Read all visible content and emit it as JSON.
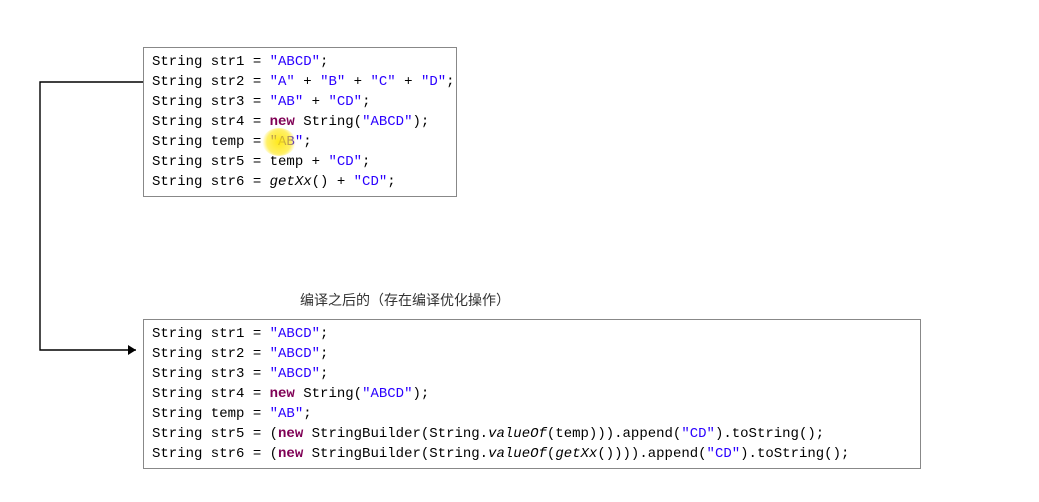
{
  "caption": "编译之后的（存在编译优化操作）",
  "top_code": {
    "lines": [
      [
        {
          "cls": "plain",
          "t": "String str1 = "
        },
        {
          "cls": "str",
          "t": "\"ABCD\""
        },
        {
          "cls": "plain",
          "t": ";"
        }
      ],
      [
        {
          "cls": "plain",
          "t": "String str2 = "
        },
        {
          "cls": "str",
          "t": "\"A\""
        },
        {
          "cls": "plain",
          "t": " + "
        },
        {
          "cls": "str",
          "t": "\"B\""
        },
        {
          "cls": "plain",
          "t": " + "
        },
        {
          "cls": "str",
          "t": "\"C\""
        },
        {
          "cls": "plain",
          "t": " + "
        },
        {
          "cls": "str",
          "t": "\"D\""
        },
        {
          "cls": "plain",
          "t": ";"
        }
      ],
      [
        {
          "cls": "plain",
          "t": "String str3 = "
        },
        {
          "cls": "str",
          "t": "\"AB\""
        },
        {
          "cls": "plain",
          "t": " + "
        },
        {
          "cls": "str",
          "t": "\"CD\""
        },
        {
          "cls": "plain",
          "t": ";"
        }
      ],
      [
        {
          "cls": "plain",
          "t": "String str4 = "
        },
        {
          "cls": "kw",
          "t": "new"
        },
        {
          "cls": "plain",
          "t": " String("
        },
        {
          "cls": "str",
          "t": "\"ABCD\""
        },
        {
          "cls": "plain",
          "t": ");"
        }
      ],
      [
        {
          "cls": "plain",
          "t": "String temp = "
        },
        {
          "cls": "str",
          "t": "\"AB\""
        },
        {
          "cls": "plain",
          "t": ";"
        }
      ],
      [
        {
          "cls": "plain",
          "t": "String str5 = temp + "
        },
        {
          "cls": "str",
          "t": "\"CD\""
        },
        {
          "cls": "plain",
          "t": ";"
        }
      ],
      [
        {
          "cls": "plain",
          "t": "String str6 = "
        },
        {
          "cls": "ital",
          "t": "getXx"
        },
        {
          "cls": "plain",
          "t": "() + "
        },
        {
          "cls": "str",
          "t": "\"CD\""
        },
        {
          "cls": "plain",
          "t": ";"
        }
      ]
    ]
  },
  "bottom_code": {
    "lines": [
      [
        {
          "cls": "plain",
          "t": "String str1 = "
        },
        {
          "cls": "str",
          "t": "\"ABCD\""
        },
        {
          "cls": "plain",
          "t": ";"
        }
      ],
      [
        {
          "cls": "plain",
          "t": "String str2 = "
        },
        {
          "cls": "str",
          "t": "\"ABCD\""
        },
        {
          "cls": "plain",
          "t": ";"
        }
      ],
      [
        {
          "cls": "plain",
          "t": "String str3 = "
        },
        {
          "cls": "str",
          "t": "\"ABCD\""
        },
        {
          "cls": "plain",
          "t": ";"
        }
      ],
      [
        {
          "cls": "plain",
          "t": "String str4 = "
        },
        {
          "cls": "kw",
          "t": "new"
        },
        {
          "cls": "plain",
          "t": " String("
        },
        {
          "cls": "str",
          "t": "\"ABCD\""
        },
        {
          "cls": "plain",
          "t": ");"
        }
      ],
      [
        {
          "cls": "plain",
          "t": "String temp = "
        },
        {
          "cls": "str",
          "t": "\"AB\""
        },
        {
          "cls": "plain",
          "t": ";"
        }
      ],
      [
        {
          "cls": "plain",
          "t": "String str5 = ("
        },
        {
          "cls": "kw",
          "t": "new"
        },
        {
          "cls": "plain",
          "t": " StringBuilder(String."
        },
        {
          "cls": "ital",
          "t": "valueOf"
        },
        {
          "cls": "plain",
          "t": "(temp))).append("
        },
        {
          "cls": "str",
          "t": "\"CD\""
        },
        {
          "cls": "plain",
          "t": ").toString();"
        }
      ],
      [
        {
          "cls": "plain",
          "t": "String str6 = ("
        },
        {
          "cls": "kw",
          "t": "new"
        },
        {
          "cls": "plain",
          "t": " StringBuilder(String."
        },
        {
          "cls": "ital",
          "t": "valueOf"
        },
        {
          "cls": "plain",
          "t": "("
        },
        {
          "cls": "ital",
          "t": "getXx"
        },
        {
          "cls": "plain",
          "t": "()))).append("
        },
        {
          "cls": "str",
          "t": "\"CD\""
        },
        {
          "cls": "plain",
          "t": ").toString();"
        }
      ]
    ]
  }
}
